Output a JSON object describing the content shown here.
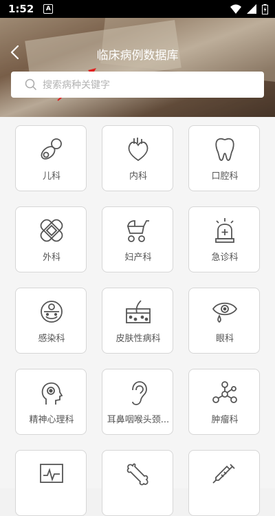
{
  "status_bar": {
    "time": "1:52",
    "notification_icon": "A"
  },
  "header": {
    "title": "临床病例数据库"
  },
  "search": {
    "placeholder": "搜索病种关键字"
  },
  "departments": [
    {
      "label": "儿科",
      "icon": "pacifier-icon"
    },
    {
      "label": "内科",
      "icon": "heart-organ-icon"
    },
    {
      "label": "口腔科",
      "icon": "tooth-icon"
    },
    {
      "label": "外科",
      "icon": "bandage-icon"
    },
    {
      "label": "妇产科",
      "icon": "baby-stroller-icon"
    },
    {
      "label": "急诊科",
      "icon": "siren-icon"
    },
    {
      "label": "感染科",
      "icon": "infection-face-icon"
    },
    {
      "label": "皮肤性病科",
      "icon": "skin-layers-icon"
    },
    {
      "label": "眼科",
      "icon": "eye-icon"
    },
    {
      "label": "精神心理科",
      "icon": "head-profile-icon"
    },
    {
      "label": "耳鼻咽喉头颈...",
      "icon": "ear-icon"
    },
    {
      "label": "肿瘤科",
      "icon": "molecule-icon"
    },
    {
      "label": "",
      "icon": "monitor-icon"
    },
    {
      "label": "",
      "icon": "bone-icon"
    },
    {
      "label": "",
      "icon": "syringe-icon"
    }
  ],
  "colors": {
    "icon_stroke": "#555555",
    "annotation_arrow": "#e02020"
  }
}
